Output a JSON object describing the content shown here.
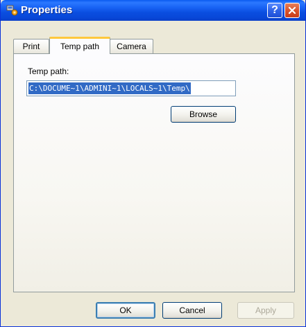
{
  "window": {
    "title": "Properties",
    "help_glyph": "?",
    "icons": {
      "app": "properties-icon",
      "help": "help-icon",
      "close": "close-icon"
    }
  },
  "tabs": [
    {
      "label": "Print",
      "active": false
    },
    {
      "label": "Temp path",
      "active": true
    },
    {
      "label": "Camera",
      "active": false
    }
  ],
  "temp_path": {
    "label": "Temp path:",
    "value": "C:\\DOCUME~1\\ADMINI~1\\LOCALS~1\\Temp\\",
    "browse_label": "Browse"
  },
  "footer": {
    "ok_label": "OK",
    "cancel_label": "Cancel",
    "apply_label": "Apply"
  },
  "colors": {
    "titlebar": "#0a4ee0",
    "selection": "#316ac5",
    "active_tab_highlight": "#ffc83c",
    "close_button": "#d9542c"
  }
}
